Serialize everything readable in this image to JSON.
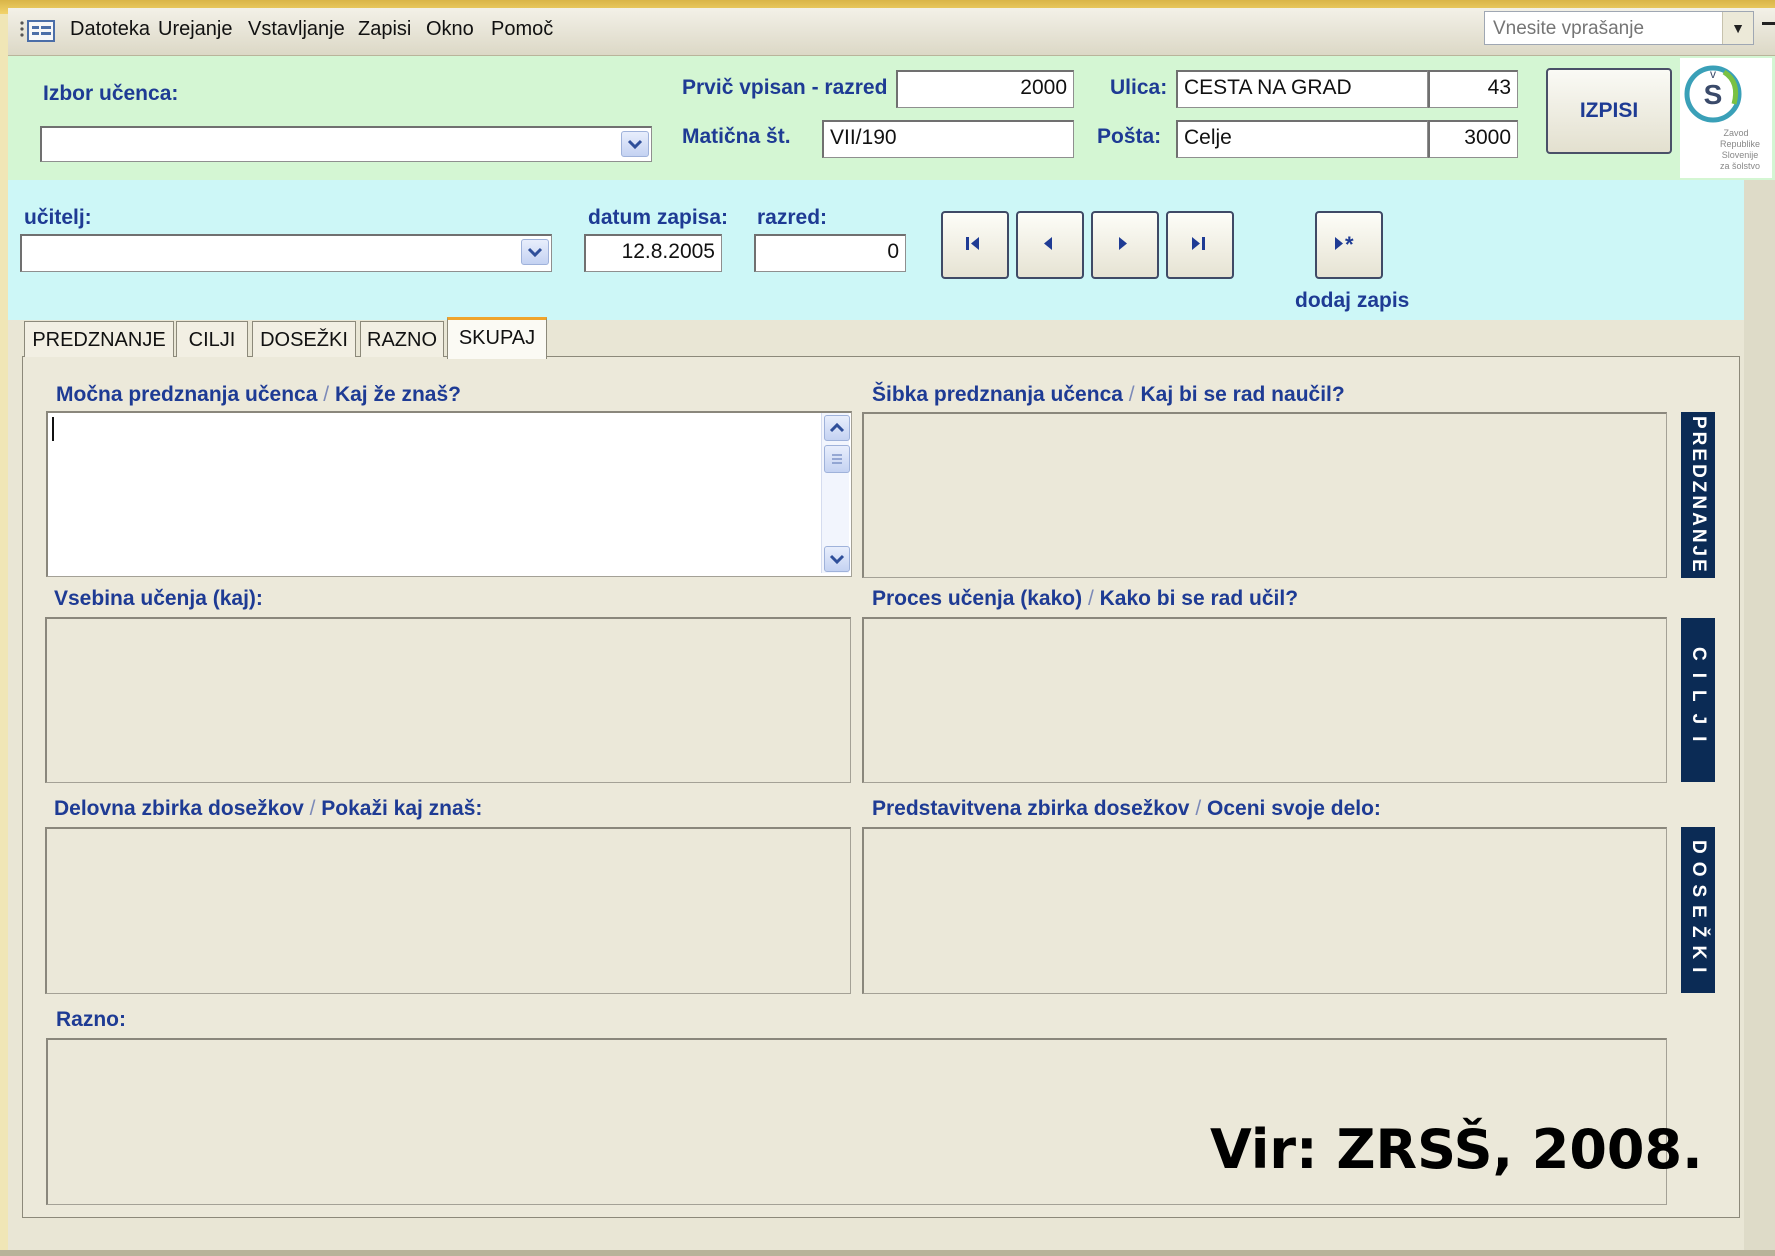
{
  "menubar": {
    "items": [
      "Datoteka",
      "Urejanje",
      "Vstavljanje",
      "Zapisi",
      "Okno",
      "Pomoč"
    ],
    "ask_placeholder": "Vnesite vprašanje"
  },
  "header": {
    "student_select_label": "Izbor učenca:",
    "student_select_value": "",
    "first_enrolled_label": "Prvič vpisan - razred",
    "first_enrolled_value": "2000",
    "reg_no_label": "Matična št.",
    "reg_no_value": "VII/190",
    "street_label": "Ulica:",
    "street_value": "CESTA NA GRAD",
    "house_no_value": "43",
    "post_label": "Pošta:",
    "post_value": "Celje",
    "post_code_value": "3000",
    "print_button": "IZPISI",
    "logo_text": "Zavod Republike Slovenije za šolstvo"
  },
  "record": {
    "teacher_label": "učitelj:",
    "teacher_value": "",
    "date_label": "datum zapisa:",
    "date_value": "12.8.2005",
    "grade_label": "razred:",
    "grade_value": "0",
    "add_record_label": "dodaj zapis"
  },
  "tabs": [
    "PREDZNANJE",
    "CILJI",
    "DOSEŽKI",
    "RAZNO",
    "SKUPAJ"
  ],
  "active_tab": "SKUPAJ",
  "sections": {
    "strong_knowledge": {
      "title": "Močna predznanja učenca",
      "subtitle": "Kaj že znaš?",
      "value": ""
    },
    "weak_knowledge": {
      "title": "Šibka predznanja učenca",
      "subtitle": "Kaj bi se rad naučil?",
      "value": ""
    },
    "content": {
      "title": "Vsebina učenja  (kaj):",
      "value": ""
    },
    "process": {
      "title": "Proces učenja  (kako)",
      "subtitle": "Kako bi se rad učil?",
      "value": ""
    },
    "working_portfolio": {
      "title": "Delovna zbirka dosežkov",
      "subtitle": "Pokaži kaj znaš:",
      "value": ""
    },
    "presentation_portfolio": {
      "title": "Predstavitvena zbirka dosežkov",
      "subtitle": "Oceni svoje delo:",
      "value": ""
    },
    "misc": {
      "title": "Razno:",
      "value": ""
    }
  },
  "side_bands": [
    "PREDZNANJE",
    "CILJI",
    "DOSEŽKI"
  ],
  "source_note": "Vir: ZRSŠ, 2008.",
  "colors": {
    "label_blue": "#1e3b94",
    "header_green": "#d4f6d3",
    "record_cyan": "#cdf7f7",
    "band_navy": "#0b2b55",
    "active_tab_accent": "#f0a42c"
  }
}
